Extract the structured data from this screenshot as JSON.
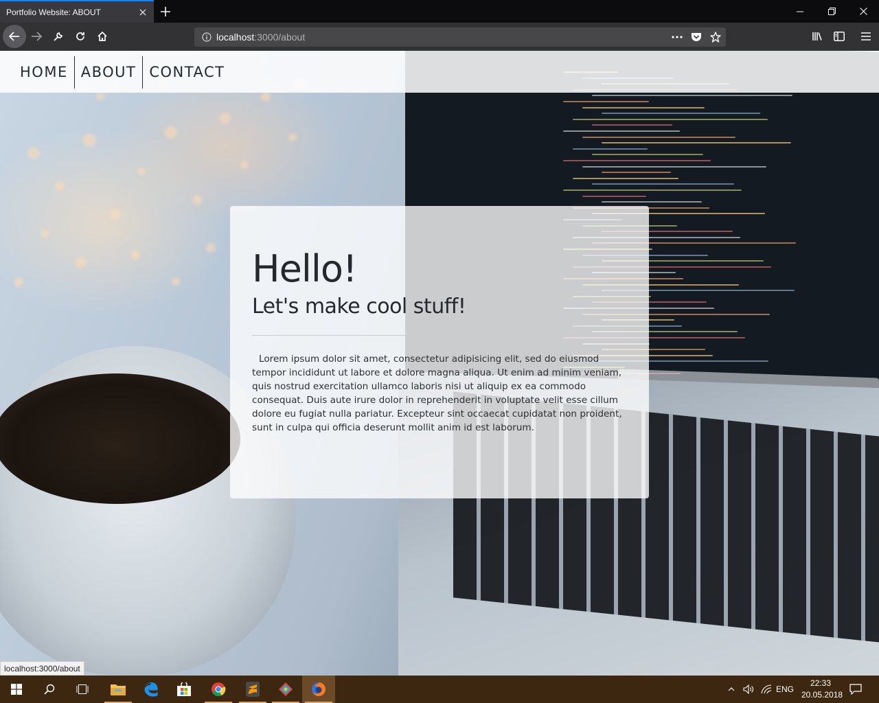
{
  "browser": {
    "tab_title": "Portfolio Website: ABOUT",
    "url_host": "localhost",
    "url_path": ":3000/about",
    "status_url": "localhost:3000/about"
  },
  "site_nav": {
    "items": [
      {
        "label": "HOME"
      },
      {
        "label": "ABOUT"
      },
      {
        "label": "CONTACT"
      }
    ]
  },
  "hero": {
    "title": "Hello!",
    "subtitle": "Let's make cool stuff!",
    "body": "Lorem ipsum dolor sit amet, consectetur adipisicing elit, sed do eiusmod tempor incididunt ut labore et dolore magna aliqua. Ut enim ad minim veniam, quis nostrud exercitation ullamco laboris nisi ut aliquip ex ea commodo consequat. Duis aute irure dolor in reprehenderit in voluptate velit esse cillum dolore eu fugiat nulla pariatur. Excepteur sint occaecat cupidatat non proident, sunt in culpa qui officia deserunt mollit anim id est laborum."
  },
  "taskbar": {
    "language": "ENG",
    "time": "22:33",
    "date": "20.05.2018"
  },
  "colors": {
    "accent_tab": "#0a84ff",
    "taskbar": "#3d2710",
    "nav_text": "#222a31"
  }
}
